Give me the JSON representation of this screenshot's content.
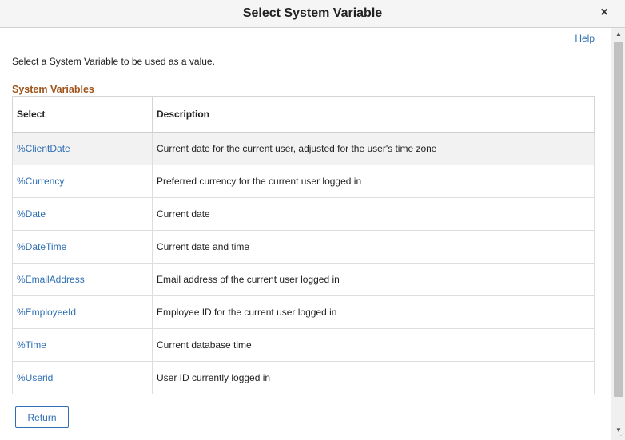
{
  "dialog": {
    "title": "Select System Variable",
    "close_glyph": "×",
    "help_label": "Help",
    "instruction": "Select a System Variable to be used as a value.",
    "section_title": "System Variables",
    "return_label": "Return"
  },
  "table": {
    "headers": {
      "select": "Select",
      "description": "Description"
    },
    "rows": [
      {
        "variable": "%ClientDate",
        "description": "Current date for the current user, adjusted for the user's time zone"
      },
      {
        "variable": "%Currency",
        "description": "Preferred currency for the current user logged in"
      },
      {
        "variable": "%Date",
        "description": "Current date"
      },
      {
        "variable": "%DateTime",
        "description": "Current date and time"
      },
      {
        "variable": "%EmailAddress",
        "description": "Email address of the current user logged in"
      },
      {
        "variable": "%EmployeeId",
        "description": "Employee ID for the current user logged in"
      },
      {
        "variable": "%Time",
        "description": "Current database time"
      },
      {
        "variable": "%Userid",
        "description": "User ID currently logged in"
      }
    ]
  },
  "icons": {
    "close": "close-icon",
    "scroll_up": "scroll-up-arrow-icon",
    "scroll_down": "scroll-down-arrow-icon",
    "resize": "resize-grip-icon"
  },
  "colors": {
    "link": "#2e6fb4",
    "section_title": "#a0541a",
    "titlebar_bg": "#f5f5f5",
    "highlight_row": "#f2f2f2"
  }
}
